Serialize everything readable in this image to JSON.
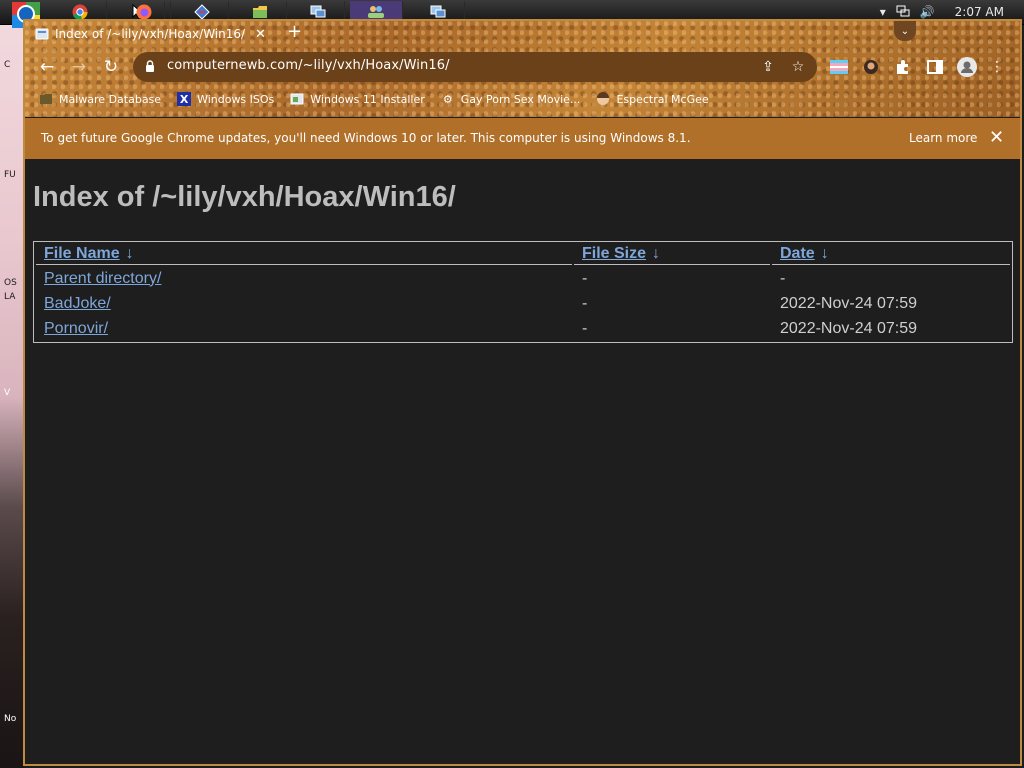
{
  "taskbar": {
    "clock": "2:07 AM"
  },
  "desktop": {
    "labels": [
      "C",
      "FU",
      "OS",
      "LA",
      "V",
      "No"
    ]
  },
  "browser": {
    "tab_title": "Index of /~lily/vxh/Hoax/Win16/",
    "url": "computernewb.com/~lily/vxh/Hoax/Win16/",
    "bookmarks": [
      {
        "label": "Malware Database"
      },
      {
        "label": "Windows ISOs"
      },
      {
        "label": "Windows 11 Installer"
      },
      {
        "label": "Gay Porn Sex Movie..."
      },
      {
        "label": "Espectral McGee"
      }
    ],
    "infobar": {
      "text": "To get future Google Chrome updates, you'll need Windows 10 or later. This computer is using Windows 8.1.",
      "learn_more": "Learn more"
    }
  },
  "page": {
    "heading": "Index of /~lily/vxh/Hoax/Win16/",
    "columns": [
      "File Name",
      "File Size",
      "Date"
    ],
    "sort_arrow": "↓",
    "rows": [
      {
        "name": "Parent directory/",
        "size": "-",
        "date": "-"
      },
      {
        "name": "BadJoke/",
        "size": "-",
        "date": "2022-Nov-24 07:59"
      },
      {
        "name": "Pornovir/",
        "size": "-",
        "date": "2022-Nov-24 07:59"
      }
    ]
  },
  "colors": {
    "chrome_theme": "#b5752e",
    "infobar": "#b0702a",
    "link": "#7fa6d9",
    "page_bg": "#1e1e1e"
  }
}
